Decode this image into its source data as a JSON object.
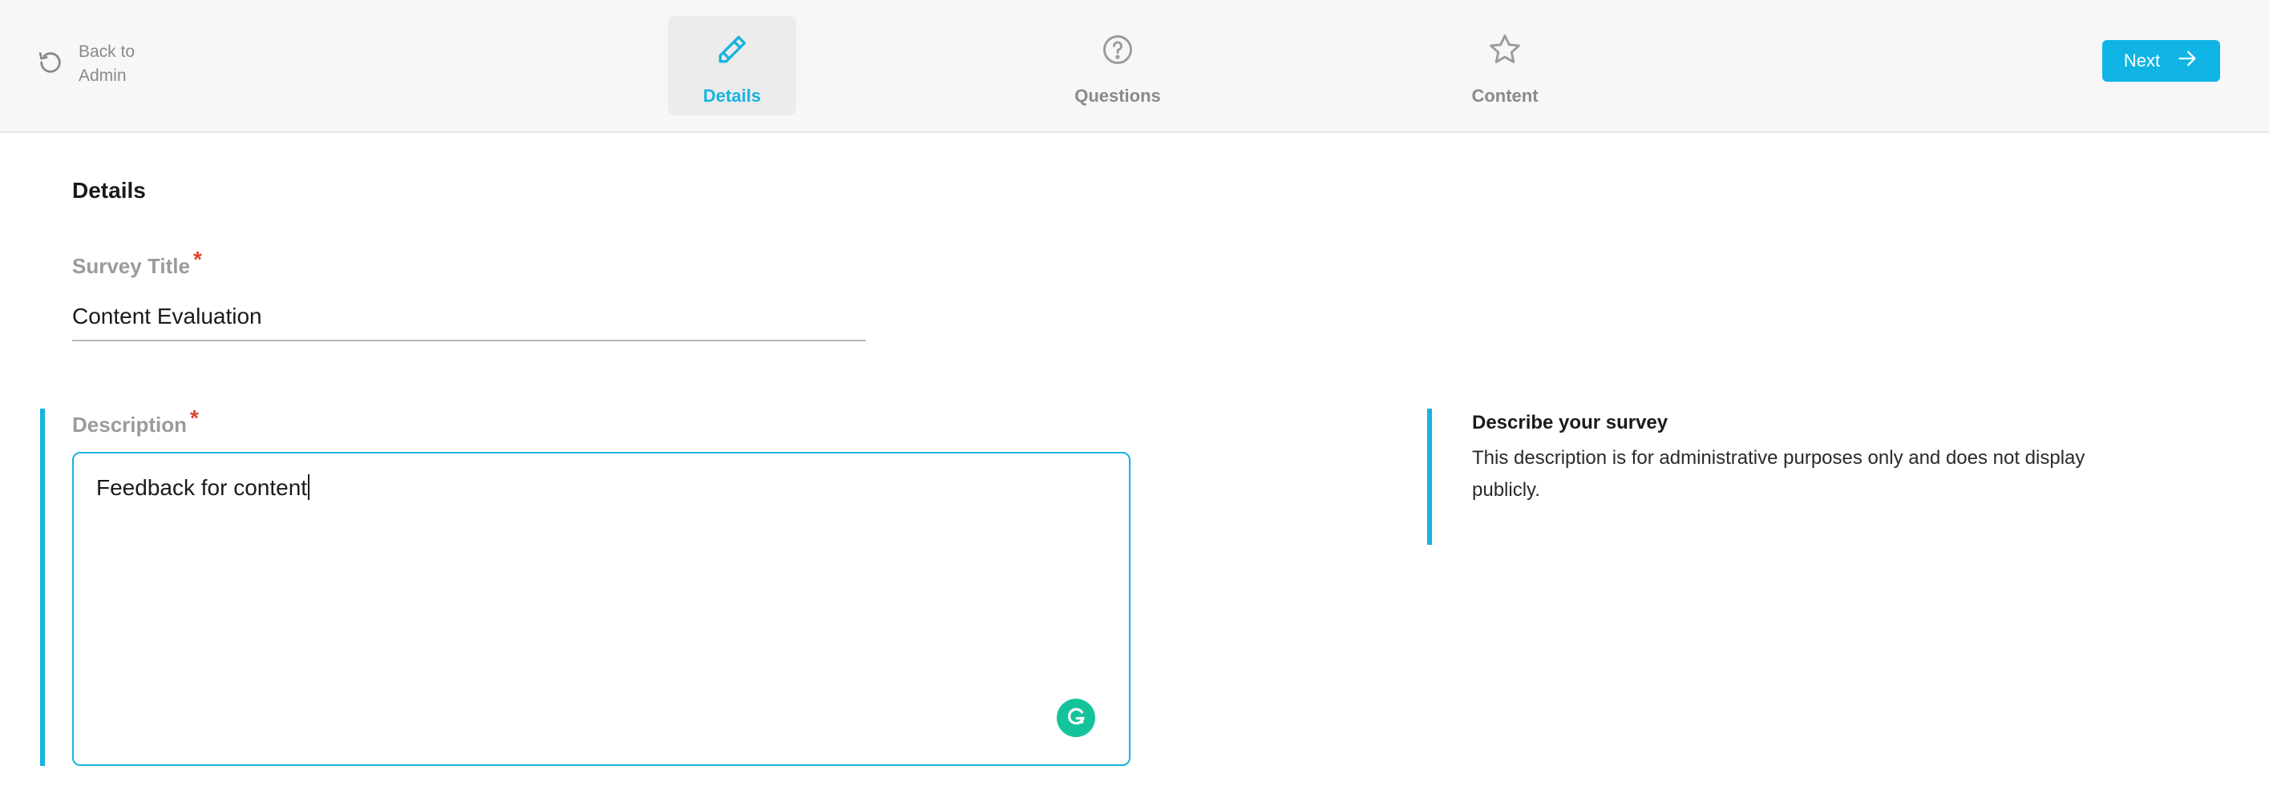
{
  "header": {
    "back_label": "Back to Admin",
    "tabs": [
      {
        "label": "Details",
        "icon": "pencil-icon",
        "active": true
      },
      {
        "label": "Questions",
        "icon": "question-circle-icon",
        "active": false
      },
      {
        "label": "Content",
        "icon": "star-icon",
        "active": false
      }
    ],
    "next_label": "Next"
  },
  "main": {
    "section_title": "Details",
    "survey_title": {
      "label": "Survey Title",
      "required_mark": "*",
      "value": "Content Evaluation"
    },
    "description": {
      "label": "Description",
      "required_mark": "*",
      "value": "Feedback for content"
    },
    "help": {
      "title": "Describe your survey",
      "text": "This description is for administrative purposes only and does not display publicly."
    }
  },
  "colors": {
    "accent": "#17b3e0",
    "button": "#10b4e4",
    "required": "#e0442b",
    "grammarly": "#15c39a"
  }
}
